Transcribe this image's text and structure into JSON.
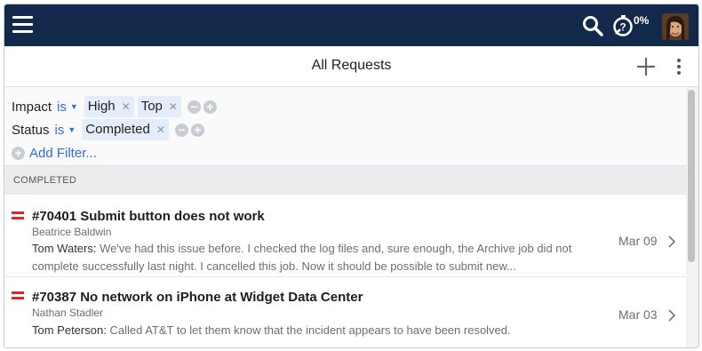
{
  "header": {
    "timer_percent": "0%"
  },
  "title": "All Requests",
  "filters": [
    {
      "field": "Impact",
      "op": "is",
      "values": [
        "High",
        "Top"
      ]
    },
    {
      "field": "Status",
      "op": "is",
      "values": [
        "Completed"
      ]
    }
  ],
  "add_filter_label": "Add Filter...",
  "section_label": "COMPLETED",
  "requests": [
    {
      "id_title": "#70401  Submit button does not work",
      "requester": "Beatrice Baldwin",
      "author": "Tom Waters:",
      "message": "We've had this issue before. I checked the log files and, sure enough, the Archive job did not complete successfully last night. I cancelled this job. Now it should be possible to submit new...",
      "date": "Mar 09",
      "priority_color": "#e0262b"
    },
    {
      "id_title": "#70387  No network on iPhone at Widget Data Center",
      "requester": "Nathan Stadler",
      "author": "Tom Peterson:",
      "message": "Called AT&T to let them know that the incident appears to have been resolved.",
      "date": "Mar 03",
      "priority_color": "#e0262b"
    }
  ],
  "icons": {
    "menu": "hamburger-icon",
    "search": "search-icon",
    "timer": "timer-icon",
    "add": "plus-icon",
    "more": "kebab-icon",
    "chevron": "chevron-right-icon"
  },
  "colors": {
    "topbar": "#13294b",
    "link": "#2a6fdb",
    "chip": "#e4eefa",
    "priority": "#e0262b"
  }
}
